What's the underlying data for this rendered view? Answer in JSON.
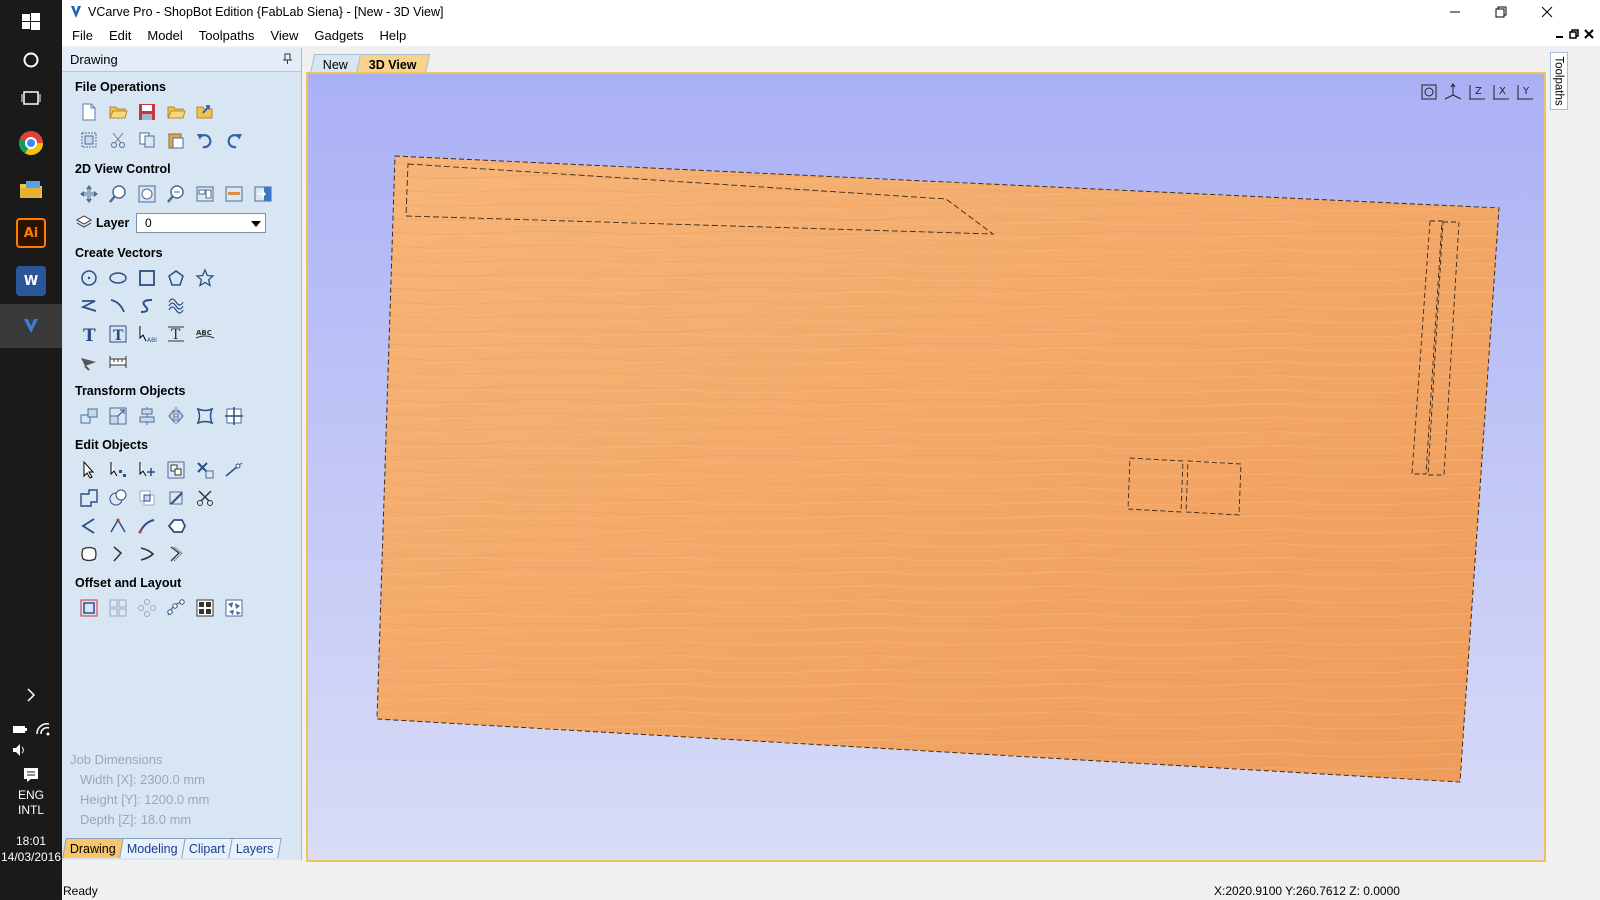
{
  "taskbar": {
    "time": "18:01",
    "date": "14/03/2016",
    "lang_line1": "ENG",
    "lang_line2": "INTL",
    "apps": [
      "windows-icon",
      "cortana-icon",
      "task-view-icon",
      "chrome-icon",
      "file-explorer-icon",
      "illustrator-icon",
      "word-icon",
      "vcarve-icon"
    ],
    "ai_label": "Ai",
    "word_label": "W"
  },
  "window": {
    "title": "VCarve Pro - ShopBot Edition {FabLab Siena} - [New - 3D View]"
  },
  "menu": [
    "File",
    "Edit",
    "Model",
    "Toolpaths",
    "View",
    "Gadgets",
    "Help"
  ],
  "panel": {
    "title": "Drawing",
    "sections": {
      "file_operations": "File Operations",
      "view_control": "2D View Control",
      "create_vectors": "Create Vectors",
      "transform_objects": "Transform Objects",
      "edit_objects": "Edit Objects",
      "offset_layout": "Offset and Layout"
    },
    "layer_label": "Layer",
    "layer_value": "0",
    "job": {
      "title": "Job Dimensions",
      "width": "Width  [X]: 2300.0 mm",
      "height": "Height [Y]: 1200.0 mm",
      "depth": "Depth  [Z]: 18.0 mm"
    },
    "bottom_tabs": [
      "Drawing",
      "Modeling",
      "Clipart",
      "Layers"
    ]
  },
  "doc_tabs": [
    "New",
    "3D View"
  ],
  "right_tab": "Toolpaths",
  "status": {
    "left": "Ready",
    "coords": "X:2020.9100 Y:260.7612 Z:  0.0000"
  },
  "colors": {
    "panel_bg": "#d8e6f4",
    "view_top": "#aab0f5",
    "view_bottom": "#d9dcf6",
    "board": "#f3a868",
    "active_tab": "#f7c66b",
    "frame": "#f2c15a"
  }
}
